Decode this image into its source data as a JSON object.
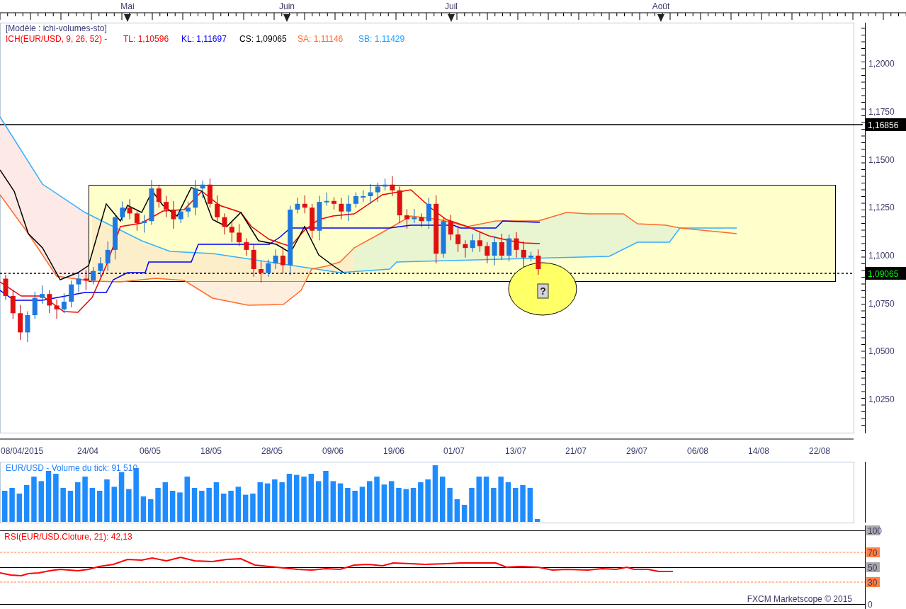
{
  "months": [
    "Mai",
    "Juin",
    "Juil",
    "Août"
  ],
  "template_label": "[Modèle : ichi-volumes-sto]",
  "legend": [
    {
      "text": "ICH(EUR/USD, 9, 26, 52) -",
      "color": "#ff0000"
    },
    {
      "text": "TL: 1,10596",
      "color": "#ff0000"
    },
    {
      "text": "KL: 1,11697",
      "color": "#0000ff"
    },
    {
      "text": "CS: 1,09065",
      "color": "#000000"
    },
    {
      "text": "SA: 1,11146",
      "color": "#ff6a2a"
    },
    {
      "text": "SB: 1,11429",
      "color": "#1ea0ff"
    }
  ],
  "price_labels": [
    "1,2000",
    "1,1750",
    "1,1500",
    "1,1250",
    "1,1000",
    "1,0750",
    "1,0500",
    "1,0250"
  ],
  "price_tags": [
    {
      "text": "1,16856",
      "color": "#ffffff"
    },
    {
      "text": "1,09065",
      "color": "#00ff00"
    }
  ],
  "marker": "?",
  "dates": [
    "08/04/2015",
    "24/04",
    "06/05",
    "18/05",
    "28/05",
    "09/06",
    "19/06",
    "01/07",
    "13/07",
    "21/07",
    "29/07",
    "06/08",
    "14/08",
    "22/08"
  ],
  "volume_label": "EUR/USD - Volume du tick: 91 510",
  "rsi_label": "RSI(EUR/USD.Cloture, 21): 42,13",
  "rsi_scale": [
    {
      "text": "100",
      "color": "#a8a8a8"
    },
    {
      "text": "70",
      "color": "#ff8040"
    },
    {
      "text": "50",
      "color": "#a8a8a8"
    },
    {
      "text": "30",
      "color": "#ff8040"
    },
    {
      "text": "0"
    }
  ],
  "copyright": "FXCM Marketscope © 2015"
}
